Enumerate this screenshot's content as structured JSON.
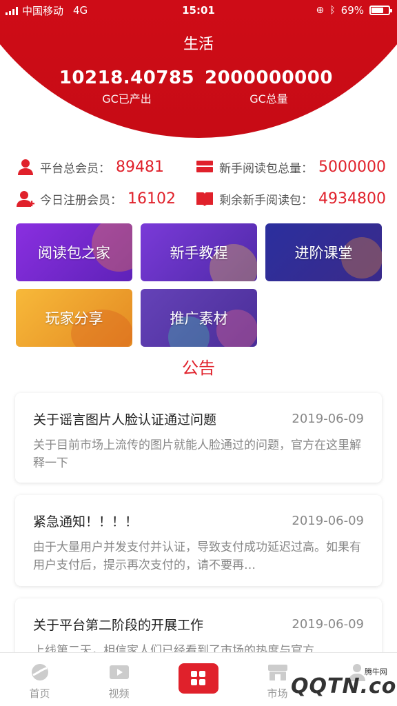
{
  "status_bar": {
    "carrier": "中国移动",
    "network": "4G",
    "time": "15:01",
    "battery": "69%",
    "battery_level": 0.69
  },
  "header": {
    "title": "生活",
    "stats": [
      {
        "value": "10218.40785",
        "label": "GC已产出"
      },
      {
        "value": "2000000000",
        "label": "GC总量"
      }
    ]
  },
  "summary": [
    {
      "label": "平台总会员：",
      "value": "89481",
      "icon": "user-icon"
    },
    {
      "label": "新手阅读包总量：",
      "value": "5000000",
      "icon": "package-icon"
    },
    {
      "label": "今日注册会员：",
      "value": "16102",
      "icon": "add-user-icon"
    },
    {
      "label": "剩余新手阅读包：",
      "value": "4934800",
      "icon": "book-icon"
    }
  ],
  "tiles": [
    {
      "label": "阅读包之家",
      "color": "#7b2fd6"
    },
    {
      "label": "新手教程",
      "color": "#6a34c9"
    },
    {
      "label": "进阶课堂",
      "color": "#2c2a9a"
    },
    {
      "label": "玩家分享",
      "color": "#f0a02a"
    },
    {
      "label": "推广素材",
      "color": "#5b3aa8"
    }
  ],
  "announcement": {
    "title": "公告",
    "items": [
      {
        "title": "关于谣言图片人脸认证通过问题",
        "date": "2019-06-09",
        "desc": "关于目前市场上流传的图片就能人脸通过的问题，官方在这里解释一下"
      },
      {
        "title": "紧急通知！！！！",
        "date": "2019-06-09",
        "desc": "由于大量用户并发支付并认证，导致支付成功延迟过高。如果有用户支付后，提示再次支付的，请不要再…"
      },
      {
        "title": "关于平台第二阶段的开展工作",
        "date": "2019-06-09",
        "desc": "上线第二天，相信家人们已经看到了市场的热度与官方"
      }
    ]
  },
  "tabbar": {
    "items": [
      {
        "label": "首页",
        "icon": "home-icon"
      },
      {
        "label": "视频",
        "icon": "video-icon"
      },
      {
        "label": "",
        "icon": "grid-icon"
      },
      {
        "label": "市场",
        "icon": "market-icon"
      },
      {
        "label": "",
        "icon": "profile-icon"
      }
    ]
  },
  "watermark": {
    "brand": "QQTN.com",
    "site": "腾牛网"
  },
  "colors": {
    "primary": "#e0212b",
    "header_red": "#d8101b"
  }
}
